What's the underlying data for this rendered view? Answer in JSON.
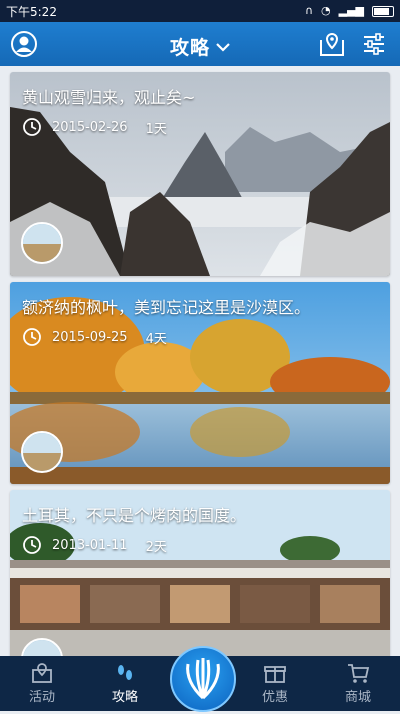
{
  "status_bar": {
    "time": "下午5:22"
  },
  "header": {
    "title": "攻略"
  },
  "cards": [
    {
      "title": "黄山观雪归来，观止矣~",
      "date": "2015-02-26",
      "days": "1天"
    },
    {
      "title": "额济纳的枫叶，美到忘记这里是沙漠区。",
      "date": "2015-09-25",
      "days": "4天"
    },
    {
      "title": "土耳其，不只是个烤肉的国度。",
      "date": "2013-01-11",
      "days": "2天"
    }
  ],
  "bottom_nav": {
    "activity": "活动",
    "guides": "攻略",
    "offers": "优惠",
    "mall": "商城"
  },
  "colors": {
    "header": "#1a73c4",
    "status_bar": "#0f1f3a",
    "bottom_nav": "#0e2746"
  }
}
